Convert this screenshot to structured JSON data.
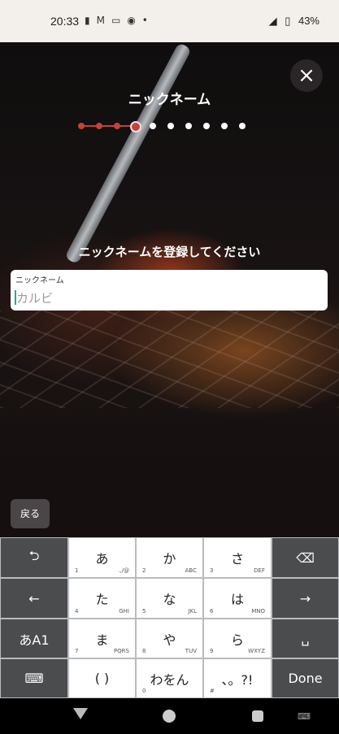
{
  "status_bar": {
    "time": "20:33",
    "left_icons": [
      "notification-icon",
      "mail-icon",
      "app-icon",
      "app-icon-2",
      "dot"
    ],
    "battery": "43%"
  },
  "screen": {
    "title": "ニックネーム",
    "progress": {
      "total_steps": 10,
      "current_step": 4
    },
    "prompt": "ニックネームを登録してください",
    "field": {
      "label": "ニックネーム",
      "placeholder": "カルビ",
      "value": ""
    },
    "back_label": "戻る",
    "close_icon": "×"
  },
  "keyboard": {
    "rows": [
      [
        "⮌",
        "あ",
        "か",
        "さ",
        "⌫"
      ],
      [
        "←",
        "た",
        "な",
        "は",
        "→"
      ],
      [
        "あA1",
        "ま",
        "や",
        "ら",
        "␣"
      ],
      [
        "⌨",
        "( )",
        "わをん",
        "、。?!",
        "Done"
      ]
    ],
    "subs": {
      "あ": [
        "1",
        ".,/@"
      ],
      "か": [
        "2",
        "ABC"
      ],
      "さ": [
        "3",
        "DEF"
      ],
      "た": [
        "4",
        "GHI"
      ],
      "な": [
        "5",
        "JKL"
      ],
      "は": [
        "6",
        "MNO"
      ],
      "ま": [
        "7",
        "PQRS"
      ],
      "や": [
        "8",
        "TUV"
      ],
      "ら": [
        "9",
        "WXYZ"
      ],
      "( )": [
        "",
        ""
      ],
      "わをん": [
        "0",
        ""
      ],
      "、。?!": [
        "#",
        ""
      ]
    }
  },
  "colors": {
    "accent": "#c7403c",
    "cursor": "#19b08a"
  }
}
